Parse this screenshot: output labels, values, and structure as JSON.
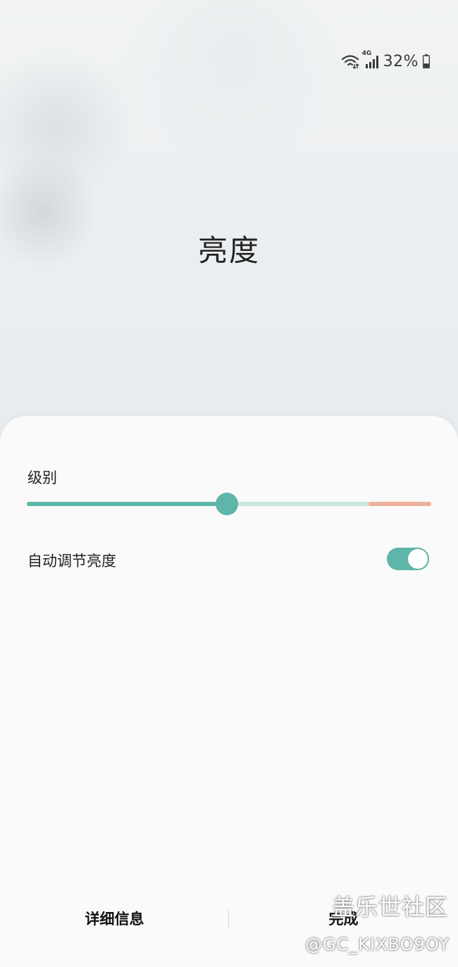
{
  "status_bar": {
    "wifi_icon": "wifi-icon",
    "network_label": "4G",
    "signal_icon": "cellular-signal-icon",
    "battery_percent": "32%",
    "battery_icon": "battery-icon",
    "battery_level": 0.32
  },
  "page": {
    "title": "亮度"
  },
  "brightness": {
    "level_label": "级别",
    "level_value": 0.495,
    "high_brightness_zone_start": 0.845,
    "colors": {
      "accent": "#5fb5a9",
      "track": "#c8e4e0",
      "high_zone": "#efb09a"
    }
  },
  "auto_brightness": {
    "label": "自动调节亮度",
    "enabled": true
  },
  "buttons": {
    "details_label": "详细信息",
    "done_label": "完成"
  },
  "watermark": {
    "line1": "盖乐世社区",
    "line2": "@GC_KIXBO9OY"
  }
}
